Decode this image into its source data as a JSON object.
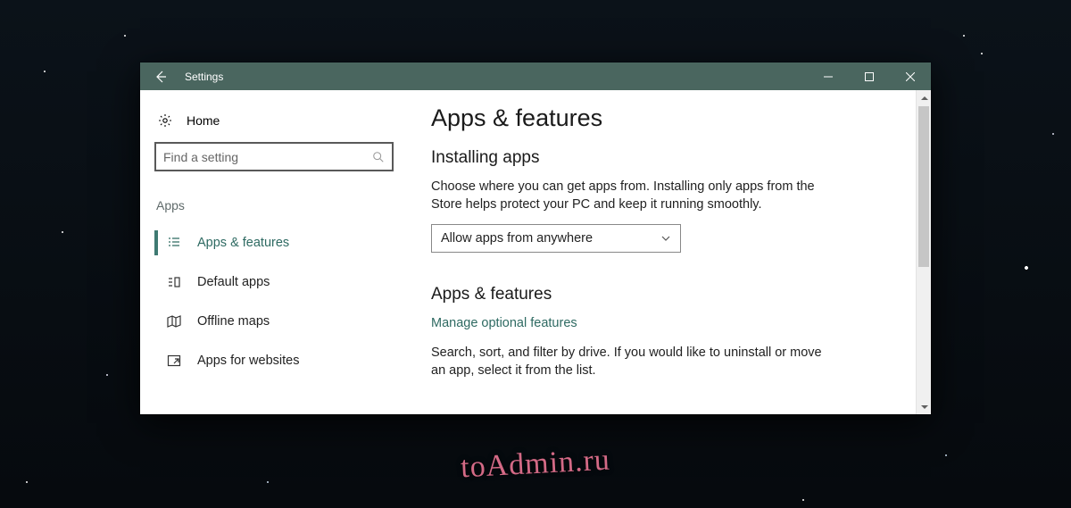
{
  "titlebar": {
    "title": "Settings"
  },
  "sidebar": {
    "home": "Home",
    "search_placeholder": "Find a setting",
    "category": "Apps",
    "items": [
      {
        "label": "Apps & features",
        "active": true
      },
      {
        "label": "Default apps"
      },
      {
        "label": "Offline maps"
      },
      {
        "label": "Apps for websites"
      }
    ]
  },
  "main": {
    "title": "Apps & features",
    "section1_heading": "Installing apps",
    "section1_body": "Choose where you can get apps from. Installing only apps from the Store helps protect your PC and keep it running smoothly.",
    "dropdown_value": "Allow apps from anywhere",
    "section2_heading": "Apps & features",
    "optional_link": "Manage optional features",
    "section2_body": "Search, sort, and filter by drive. If you would like to uninstall or move an app, select it from the list."
  },
  "watermark": "toAdmin.ru",
  "colors": {
    "accent": "#4a665f",
    "link": "#2e6a62"
  }
}
